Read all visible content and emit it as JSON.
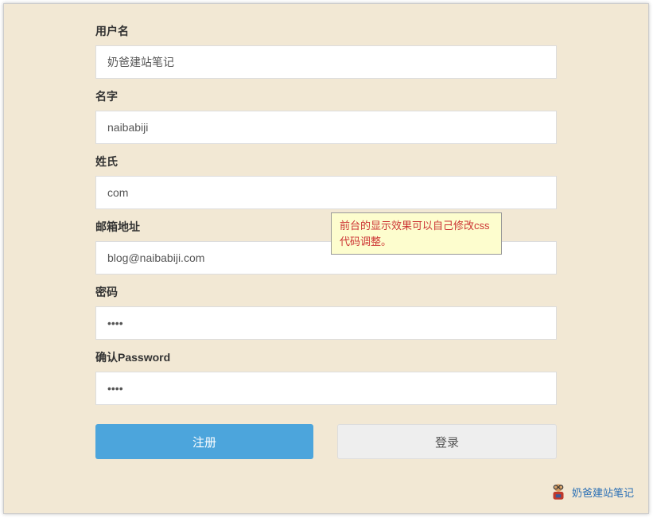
{
  "form": {
    "username": {
      "label": "用户名",
      "value": "奶爸建站笔记"
    },
    "firstname": {
      "label": "名字",
      "value": "naibabiji"
    },
    "lastname": {
      "label": "姓氏",
      "value": "com"
    },
    "email": {
      "label": "邮箱地址",
      "value": "blog@naibabiji.com"
    },
    "password": {
      "label": "密码",
      "value": "••••"
    },
    "confirm": {
      "label": "确认Password",
      "value": "••••"
    }
  },
  "buttons": {
    "register": "注册",
    "login": "登录"
  },
  "tooltip": "前台的显示效果可以自己修改css代码调整。",
  "watermark": "奶爸建站笔记"
}
